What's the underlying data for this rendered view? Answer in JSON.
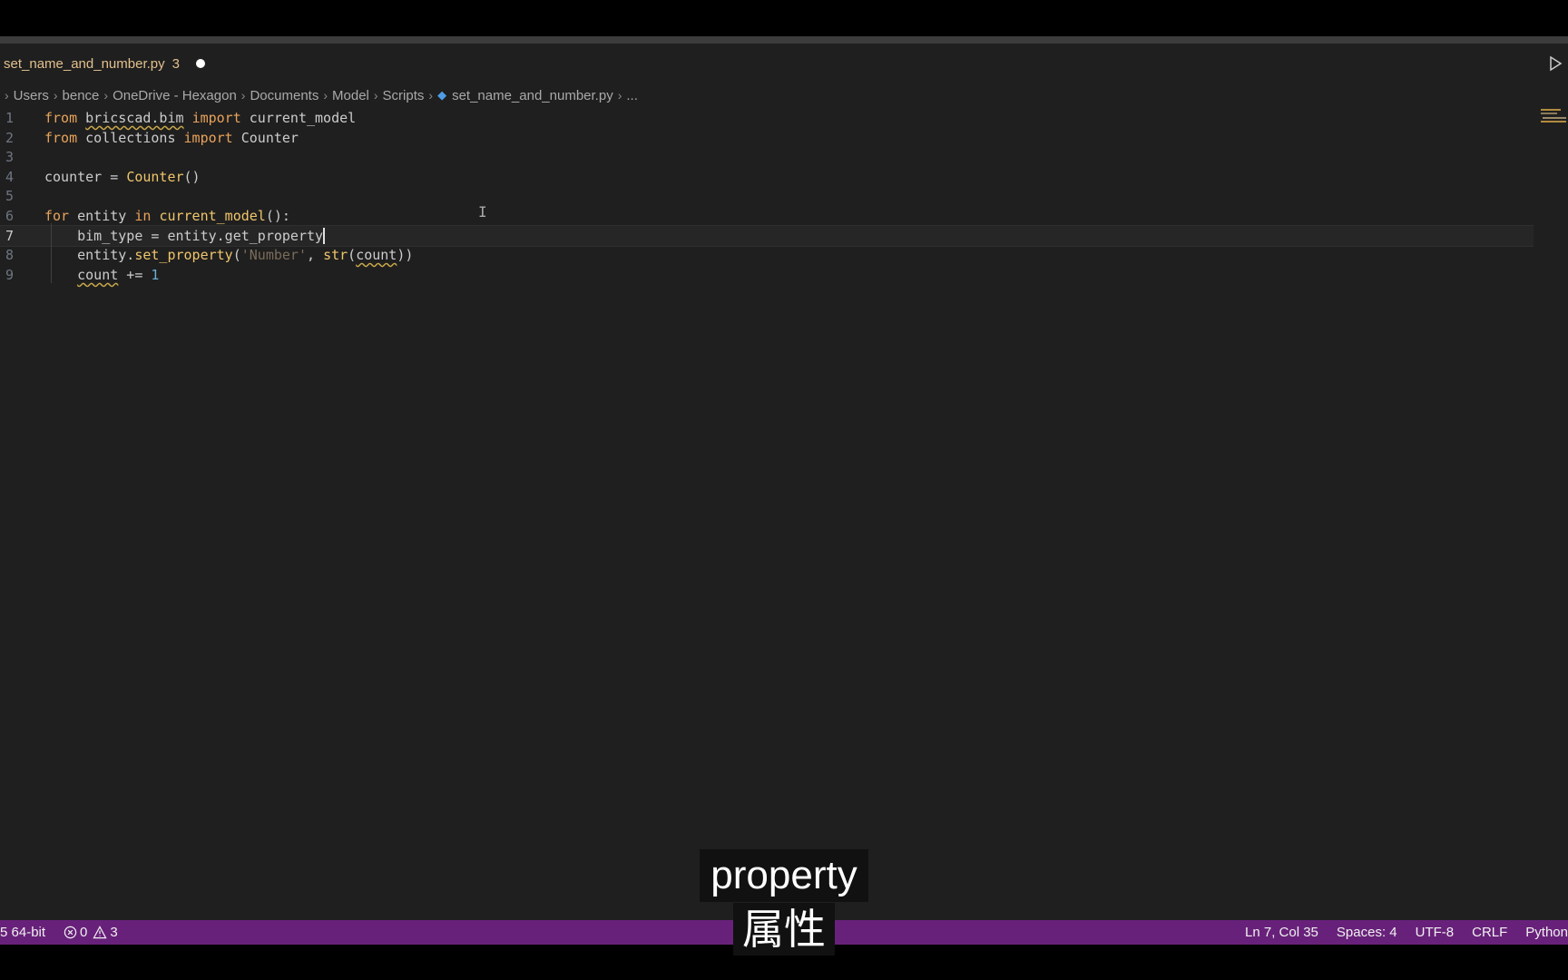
{
  "tab": {
    "filename": "set_name_and_number.py",
    "problems_count": "3"
  },
  "breadcrumb": [
    {
      "label": "Users"
    },
    {
      "label": "bence"
    },
    {
      "label": "OneDrive - Hexagon"
    },
    {
      "label": "Documents"
    },
    {
      "label": "Model"
    },
    {
      "label": "Scripts"
    },
    {
      "label": "set_name_and_number.py",
      "icon": "python-icon"
    },
    {
      "label": "..."
    }
  ],
  "editor": {
    "lines": [
      {
        "n": "1",
        "tokens": [
          {
            "t": "from",
            "c": "kw"
          },
          {
            "t": " "
          },
          {
            "t": "bricscad.bim",
            "s": true
          },
          {
            "t": " "
          },
          {
            "t": "import",
            "c": "kw"
          },
          {
            "t": " current_model"
          }
        ]
      },
      {
        "n": "2",
        "tokens": [
          {
            "t": "from",
            "c": "kw"
          },
          {
            "t": " collections "
          },
          {
            "t": "import",
            "c": "kw"
          },
          {
            "t": " Counter"
          }
        ]
      },
      {
        "n": "3",
        "tokens": []
      },
      {
        "n": "4",
        "tokens": [
          {
            "t": "counter = "
          },
          {
            "t": "Counter",
            "c": "fn"
          },
          {
            "t": "()"
          }
        ]
      },
      {
        "n": "5",
        "tokens": []
      },
      {
        "n": "6",
        "tokens": [
          {
            "t": "for",
            "c": "kw"
          },
          {
            "t": " entity "
          },
          {
            "t": "in",
            "c": "kw"
          },
          {
            "t": " "
          },
          {
            "t": "current_model",
            "c": "fn"
          },
          {
            "t": "():"
          }
        ]
      },
      {
        "n": "7",
        "current": true,
        "caret": true,
        "tokens": [
          {
            "t": "    bim_type = entity.get_property"
          }
        ]
      },
      {
        "n": "8",
        "tokens": [
          {
            "t": "    entity."
          },
          {
            "t": "set_property",
            "c": "fn"
          },
          {
            "t": "("
          },
          {
            "t": "'Number'",
            "c": "str"
          },
          {
            "t": ", "
          },
          {
            "t": "str",
            "c": "fn"
          },
          {
            "t": "("
          },
          {
            "t": "count",
            "s": true
          },
          {
            "t": "))"
          }
        ]
      },
      {
        "n": "9",
        "tokens": [
          {
            "t": "    "
          },
          {
            "t": "count",
            "s": true
          },
          {
            "t": " += "
          },
          {
            "t": "1",
            "c": "num"
          }
        ]
      }
    ]
  },
  "statusbar": {
    "interpreter": "5 64-bit",
    "errors": "0",
    "warnings": "3",
    "position": "Ln 7, Col 35",
    "spaces": "Spaces: 4",
    "encoding": "UTF-8",
    "eol": "CRLF",
    "language": "Python"
  },
  "subtitles": {
    "en": "property",
    "zh": "属性"
  },
  "colors": {
    "status_bar": "#68217a",
    "editor_bg": "#1f1f1f",
    "keyword": "#e8a35a",
    "function": "#f0c66b"
  }
}
